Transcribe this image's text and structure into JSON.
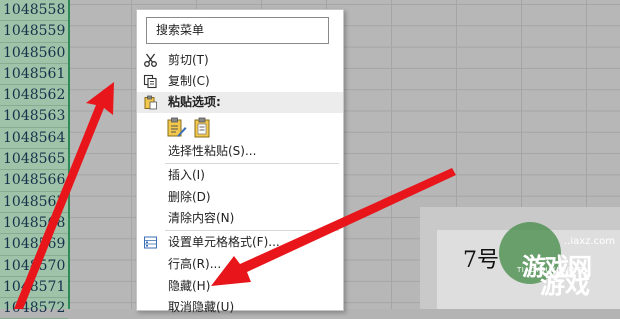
{
  "row_numbers": [
    "1048558",
    "1048559",
    "1048560",
    "1048561",
    "1048562",
    "1048563",
    "1048564",
    "1048565",
    "1048566",
    "1048567",
    "1048568",
    "1048569",
    "1048570",
    "1048571",
    "1048572"
  ],
  "context_menu": {
    "search_placeholder": "搜索菜单",
    "items": {
      "cut": "剪切(T)",
      "copy": "复制(C)",
      "paste_options": "粘贴选项:",
      "paste_special": "选择性粘贴(S)...",
      "insert": "插入(I)",
      "delete": "删除(D)",
      "clear_contents": "清除内容(N)",
      "format_cells": "设置单元格格式(F)...",
      "row_height": "行高(R)...",
      "hide": "隐藏(H)",
      "unhide": "取消隐藏(U)"
    },
    "icons": [
      "scissors-icon",
      "copy-icon",
      "clipboard-icon",
      "paste-icon",
      "paste-values-icon",
      "format-cells-icon"
    ]
  },
  "annotation_colors": {
    "arrow": "#e8151b"
  },
  "watermark": {
    "tag": "7号",
    "domain": "..iaxz.com",
    "text_main": "游戏网",
    "text_romanized": "TIAOYOUXIWANG",
    "text_secondary": "游戏"
  }
}
